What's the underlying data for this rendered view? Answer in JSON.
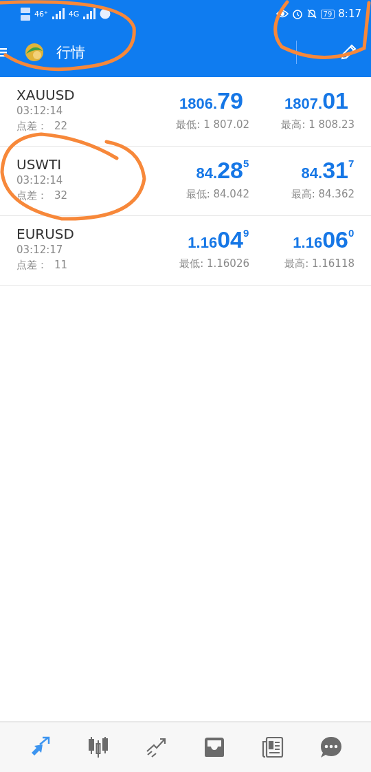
{
  "status_bar": {
    "network_left": "46⁺",
    "network_right": "4G",
    "battery": "79",
    "time": "8:17"
  },
  "toolbar": {
    "title": "行情"
  },
  "quotes": [
    {
      "symbol": "XAUUSD",
      "time": "03:12:14",
      "spread_label": "点差：",
      "spread": "22",
      "bid": {
        "prefix": "1806.",
        "big": "79"
      },
      "ask": {
        "prefix": "1807.",
        "big": "01"
      },
      "low": "最低: 1 807.02",
      "high": "最高: 1 808.23"
    },
    {
      "symbol": "USWTI",
      "time": "03:12:14",
      "spread_label": "点差：",
      "spread": "32",
      "bid": {
        "prefix": "84.",
        "big": "28",
        "sup": "5"
      },
      "ask": {
        "prefix": "84.",
        "big": "31",
        "sup": "7"
      },
      "low": "最低: 84.042",
      "high": "最高: 84.362"
    },
    {
      "symbol": "EURUSD",
      "time": "03:12:17",
      "spread_label": "点差：",
      "spread": "11",
      "bid": {
        "prefix": "1.16",
        "big": "04",
        "sup": "9"
      },
      "ask": {
        "prefix": "1.16",
        "big": "06",
        "sup": "0"
      },
      "low": "最低: 1.16026",
      "high": "最高: 1.16118"
    }
  ],
  "bottom_nav": [
    {
      "kind": "quotes",
      "selected": true
    },
    {
      "kind": "chart",
      "selected": false
    },
    {
      "kind": "trade",
      "selected": false
    },
    {
      "kind": "inbox",
      "selected": false
    },
    {
      "kind": "news",
      "selected": false
    },
    {
      "kind": "chat",
      "selected": false
    }
  ]
}
